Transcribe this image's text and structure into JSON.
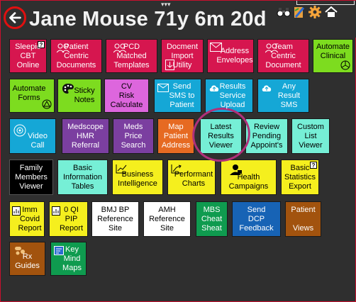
{
  "header": {
    "title": "Jane Mouse 71y 6m 20d",
    "back_icon": "back-arrow-icon",
    "top_icons": [
      "binoculars-icon",
      "note-pen-icon",
      "gear-icon",
      "home-icon"
    ]
  },
  "tiles": {
    "sleepio": "Sleepio\nCBT\nOnline",
    "patient_centric": "Patient\nCentric\nDocuments",
    "pcd_matched": "PCD\nMatched\nTemplates",
    "document_import": "Docment\nImport\nUtility",
    "address_envelopes": "Address\nEnvelopes",
    "team_centric": "Team\nCentric\nDocument",
    "automate_clinical": "Automate\nClinical",
    "automate_forms": "Automate\nForms",
    "sticky_notes": "Sticky\nNotes",
    "cv_risk": "CV\nRisk\nCalculate",
    "send_sms": "Send\nSMS to\nPatient",
    "results_upload": "Results\nService\nUpload",
    "any_result_sms": "Any\nResult\nSMS",
    "video_call": "Video\nCall",
    "medscope": "Medscope\nHMR\nReferral",
    "meds_price": "Meds\nPrice\nSearch",
    "map_patient": "Map\nPatient\nAddress",
    "latest_results": "Latest\nResults\nViewer",
    "review_pending": "Review\nPending\nAppoint's",
    "custom_list": "Custom\nList\nViewer",
    "family_members": "Family\nMembers\nViewer",
    "basic_info": "Basic\nInformation\nTables",
    "business_intel": "Business\nIntelligence",
    "performant_charts": "Performant\nCharts",
    "health_campaigns": "Health\nCampaigns",
    "basic_stats": "Basic\nStatistics\nExport",
    "imm_covid": "Imm\nCovid\nReport",
    "qi_pip": "0 QI\nPIP\nReport",
    "bmj_bp": "BMJ BP\nReference\nSite",
    "amh_ref": "AMH\nReference\nSite",
    "mbs_cheat": "MBS\nCheat\nSheat",
    "send_dcp": "Send\nDCP\nFeedback",
    "patient_views": "Patient\n\nViews",
    "rx_guides": "Rx\nGuides",
    "key_mind_maps": "Key\nMind\nMaps"
  },
  "help_mark": "?",
  "colors": {
    "crimson": "#d6164f",
    "lime": "#7ddc1f",
    "purple_pink": "#dd66dd",
    "cyan": "#15a7d6",
    "teal_light": "#76efd6",
    "violet": "#7b3fa0",
    "orange": "#e66a22",
    "yellow": "#f5ef1e",
    "white": "#ffffff",
    "green": "#0f9b4f",
    "blue": "#1763b5",
    "brown": "#a2530e",
    "annotation": "#b0307a"
  }
}
